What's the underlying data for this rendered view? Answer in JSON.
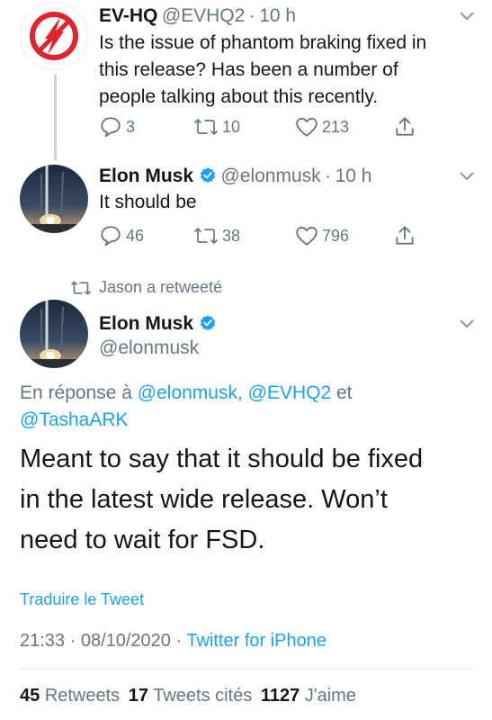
{
  "reply_tweet": {
    "author_name": "EV-HQ",
    "author_handle": "@EVHQ2",
    "sep": "·",
    "time": "10 h",
    "text_lines": [
      "Is the issue of phantom braking fixed in",
      "this release? Has been a number of",
      "people talking about this recently."
    ],
    "replies": "3",
    "retweets": "10",
    "likes": "213"
  },
  "musk_reply": {
    "author_name": "Elon Musk",
    "author_handle": "@elonmusk",
    "sep": "·",
    "time": "10 h",
    "text": "It should be",
    "replies": "46",
    "retweets": "38",
    "likes": "796"
  },
  "retweet_context": {
    "label": "Jason a retweeté"
  },
  "main_tweet": {
    "author_name": "Elon Musk",
    "author_handle": "@elonmusk",
    "reply_prefix": "En réponse à",
    "reply_mentions_line1": "@elonmusk, @EVHQ2",
    "reply_and": "et",
    "reply_mentions_line2": "@TashaARK",
    "text_lines": [
      "Meant to say that it should be fixed",
      "in the latest wide release. Won’t",
      "need to wait for FSD."
    ],
    "translate": "Traduire le Tweet",
    "timestamp": "21:33 · 08/10/2020",
    "dot": "·",
    "source": "Twitter for iPhone",
    "stats": {
      "retweets_count": "45",
      "retweets_label": "Retweets",
      "quotes_count": "17",
      "quotes_label": "Tweets cités",
      "likes_count": "1127",
      "likes_label": "J'aime"
    }
  },
  "colors": {
    "accent": "#1da1f2",
    "secondary_text": "#657786",
    "logo_red": "#e0262d"
  }
}
